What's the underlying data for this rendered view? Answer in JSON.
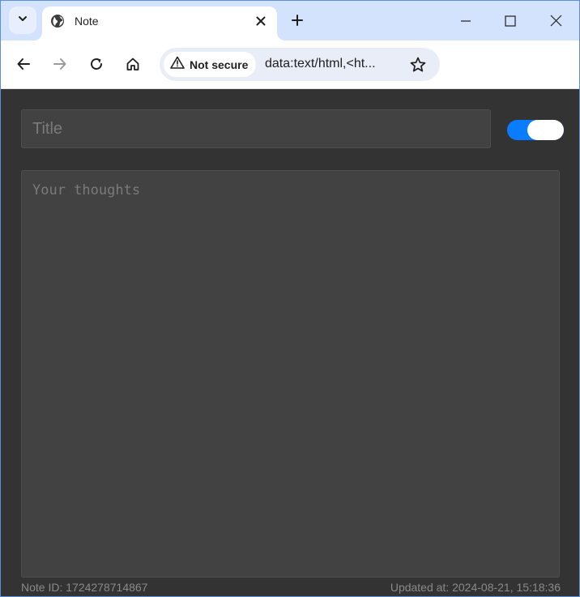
{
  "browser": {
    "tab": {
      "title": "Note",
      "favicon": "globe-icon"
    },
    "address_bar": {
      "security_label": "Not secure",
      "url": "data:text/html,<ht..."
    },
    "colors": {
      "tabstrip": "#d3e3fd",
      "omnibox": "#e8edf7"
    }
  },
  "note": {
    "title_placeholder": "Title",
    "title_value": "",
    "body_placeholder": "Your thoughts",
    "body_value": "",
    "toggle_on": true,
    "note_id_text": "Note ID: 1724278714867",
    "updated_text": "Updated at: 2024-08-21, 15:18:36",
    "colors": {
      "background": "#333333",
      "field": "#424242",
      "toggle_accent": "#0a7cff"
    }
  }
}
